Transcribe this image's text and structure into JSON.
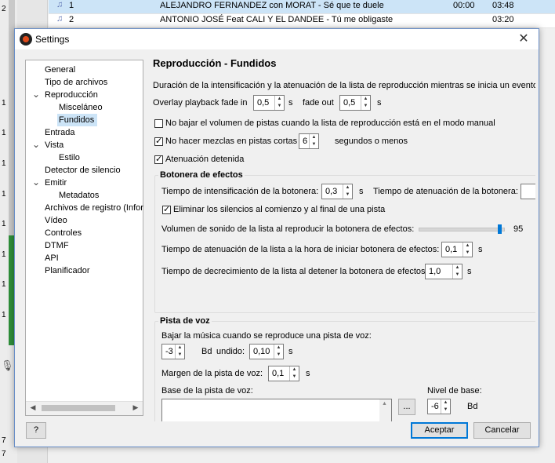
{
  "background": {
    "row_numbers": [
      "2",
      "1",
      "1",
      "1",
      "1",
      "1",
      "1",
      "1",
      "1",
      "7",
      "7"
    ],
    "playlist": [
      {
        "num": "1",
        "title": "ALEJANDRO FERNANDEZ con MORAT - Sé que te duele",
        "pos": "00:00",
        "dur": "03:48"
      },
      {
        "num": "2",
        "title": "ANTONIO JOSÉ Feat CALI Y EL DANDEE - Tú me obligaste",
        "pos": "",
        "dur": "03:20"
      }
    ]
  },
  "dialog": {
    "title": "Settings",
    "tree": [
      {
        "label": "General",
        "indent": 0,
        "expander": ""
      },
      {
        "label": "Tipo de archivos",
        "indent": 0,
        "expander": ""
      },
      {
        "label": "Reproducción",
        "indent": 0,
        "expander": "v"
      },
      {
        "label": "Misceláneo",
        "indent": 1,
        "expander": ""
      },
      {
        "label": "Fundidos",
        "indent": 1,
        "expander": "",
        "selected": true
      },
      {
        "label": "Entrada",
        "indent": 0,
        "expander": ""
      },
      {
        "label": "Vista",
        "indent": 0,
        "expander": "v"
      },
      {
        "label": "Estilo",
        "indent": 1,
        "expander": ""
      },
      {
        "label": "Detector de silencio",
        "indent": 0,
        "expander": ""
      },
      {
        "label": "Emitir",
        "indent": 0,
        "expander": "v"
      },
      {
        "label": "Metadatos",
        "indent": 1,
        "expander": ""
      },
      {
        "label": "Archivos de registro (Infor",
        "indent": 0,
        "expander": ""
      },
      {
        "label": "Vídeo",
        "indent": 0,
        "expander": ""
      },
      {
        "label": "Controles",
        "indent": 0,
        "expander": ""
      },
      {
        "label": "DTMF",
        "indent": 0,
        "expander": ""
      },
      {
        "label": "API",
        "indent": 0,
        "expander": ""
      },
      {
        "label": "Planificador",
        "indent": 0,
        "expander": ""
      }
    ],
    "page": {
      "heading": "Reproducción - Fundidos",
      "description": "Duración de la intensificación y la atenuación de la lista de reproducción mientras se inicia un evento o",
      "overlay_label": "Overlay playback fade in",
      "overlay_in_value": "0,5",
      "unit_s": "s",
      "fade_out_label": "fade out",
      "fade_out_value": "0,5",
      "manual_label": "No bajar el volumen de pistas cuando la lista de reproducción está en el modo manual",
      "manual_checked": false,
      "nomix_label": "No hacer mezclas en pistas cortas",
      "nomix_checked": true,
      "nomix_value": "6",
      "nomix_suffix": "segundos o menos",
      "stop_label": "Atenuación detenida",
      "stop_checked": true,
      "botonera": {
        "title": "Botonera de efectos",
        "intens_label": "Tiempo de intensificación de la botonera:",
        "intens_value": "0,3",
        "aten_label": "Tiempo de atenuación de la botonera:",
        "silence_label": "Eliminar los silencios al comienzo y al final de una pista",
        "silence_checked": true,
        "volume_label": "Volumen de sonido de la lista al reproducir la botonera de efectos:",
        "volume_value": "95",
        "volume_level": 0.95,
        "list_aten_label": "Tiempo de atenuación de la lista a la hora de iniciar botonera de efectos:",
        "list_aten_value": "0,1",
        "list_decr_label": "Tiempo de decrecimiento de la lista al detener la botonera de efectos:",
        "list_decr_value": "1,0"
      },
      "voz": {
        "title": "Pista de voz",
        "lower_label": "Bajar la música cuando se reproduce una pista de voz:",
        "lower_value": "-3",
        "bd_label": "Bd",
        "fund_label": "undido:",
        "fund_value": "0,10",
        "margin_label": "Margen de la pista de voz:",
        "margin_value": "0,1",
        "base_label": "Base de la pista de voz:",
        "browse_label": "...",
        "level_label": "Nivel de base:",
        "level_value": "-6",
        "level_unit": "Bd"
      }
    },
    "buttons": {
      "help": "?",
      "accept": "Aceptar",
      "cancel": "Cancelar"
    }
  }
}
